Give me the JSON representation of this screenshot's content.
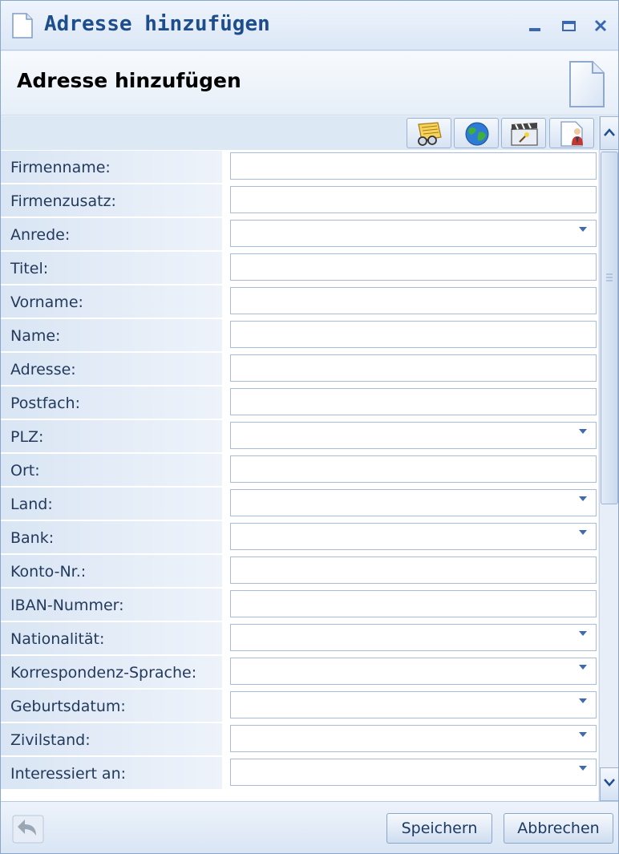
{
  "window": {
    "title": "Adresse hinzufügen",
    "controls": [
      "minimize-icon",
      "maximize-icon",
      "close-icon"
    ]
  },
  "header": {
    "title": "Adresse hinzufügen",
    "icon": "document-icon"
  },
  "toolbar": {
    "buttons": [
      "glasses-notes-icon",
      "globe-icon",
      "clapperboard-icon",
      "person-document-icon"
    ]
  },
  "form": {
    "fields": [
      {
        "label": "Firmenname:",
        "type": "text",
        "value": ""
      },
      {
        "label": "Firmenzusatz:",
        "type": "text",
        "value": ""
      },
      {
        "label": "Anrede:",
        "type": "select",
        "value": ""
      },
      {
        "label": "Titel:",
        "type": "text",
        "value": ""
      },
      {
        "label": "Vorname:",
        "type": "text",
        "value": ""
      },
      {
        "label": "Name:",
        "type": "text",
        "value": ""
      },
      {
        "label": "Adresse:",
        "type": "text",
        "value": ""
      },
      {
        "label": "Postfach:",
        "type": "text",
        "value": ""
      },
      {
        "label": "PLZ:",
        "type": "select",
        "value": ""
      },
      {
        "label": "Ort:",
        "type": "text",
        "value": ""
      },
      {
        "label": "Land:",
        "type": "select",
        "value": ""
      },
      {
        "label": "Bank:",
        "type": "select",
        "value": ""
      },
      {
        "label": "Konto-Nr.:",
        "type": "text",
        "value": ""
      },
      {
        "label": "IBAN-Nummer:",
        "type": "text",
        "value": ""
      },
      {
        "label": "Nationalität:",
        "type": "select",
        "value": ""
      },
      {
        "label": "Korrespondenz-Sprache:",
        "type": "select",
        "value": ""
      },
      {
        "label": "Geburtsdatum:",
        "type": "select",
        "value": ""
      },
      {
        "label": "Zivilstand:",
        "type": "select",
        "value": ""
      },
      {
        "label": "Interessiert an:",
        "type": "select",
        "value": ""
      }
    ]
  },
  "footer": {
    "undo_icon": "undo-arrow-icon",
    "save_label": "Speichern",
    "cancel_label": "Abbrechen"
  },
  "colors": {
    "title_text": "#1e4d8c",
    "label_bg": "#d9e5f4",
    "field_border": "#a7bcd8",
    "dropdown_arrow": "#3d6ab3"
  }
}
